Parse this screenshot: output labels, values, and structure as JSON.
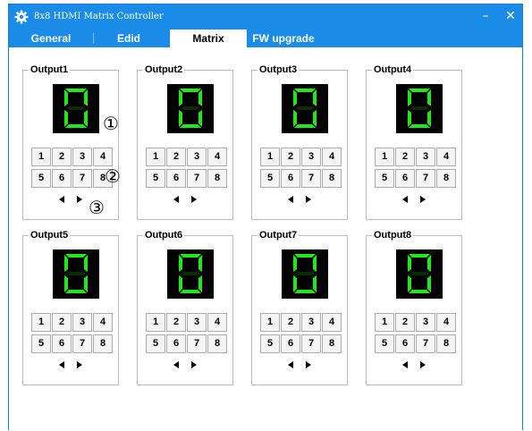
{
  "window": {
    "title": "8x8 HDMI Matrix Controller",
    "minimize": "–",
    "close": "✕"
  },
  "tabs": [
    {
      "label": "General",
      "active": false
    },
    {
      "label": "Edid",
      "active": false
    },
    {
      "label": "Matrix",
      "active": true
    },
    {
      "label": "FW upgrade",
      "active": false
    }
  ],
  "outputs": [
    {
      "label": "Output1",
      "value": "0"
    },
    {
      "label": "Output2",
      "value": "0"
    },
    {
      "label": "Output3",
      "value": "0"
    },
    {
      "label": "Output4",
      "value": "0"
    },
    {
      "label": "Output5",
      "value": "0"
    },
    {
      "label": "Output6",
      "value": "0"
    },
    {
      "label": "Output7",
      "value": "0"
    },
    {
      "label": "Output8",
      "value": "0"
    }
  ],
  "input_buttons": [
    "1",
    "2",
    "3",
    "4",
    "5",
    "6",
    "7",
    "8"
  ],
  "callouts": [
    "①",
    "②",
    "③"
  ],
  "colors": {
    "titlebar": "#1a8ce8",
    "segment_on": "#22e81a",
    "display_bg": "#000000"
  }
}
